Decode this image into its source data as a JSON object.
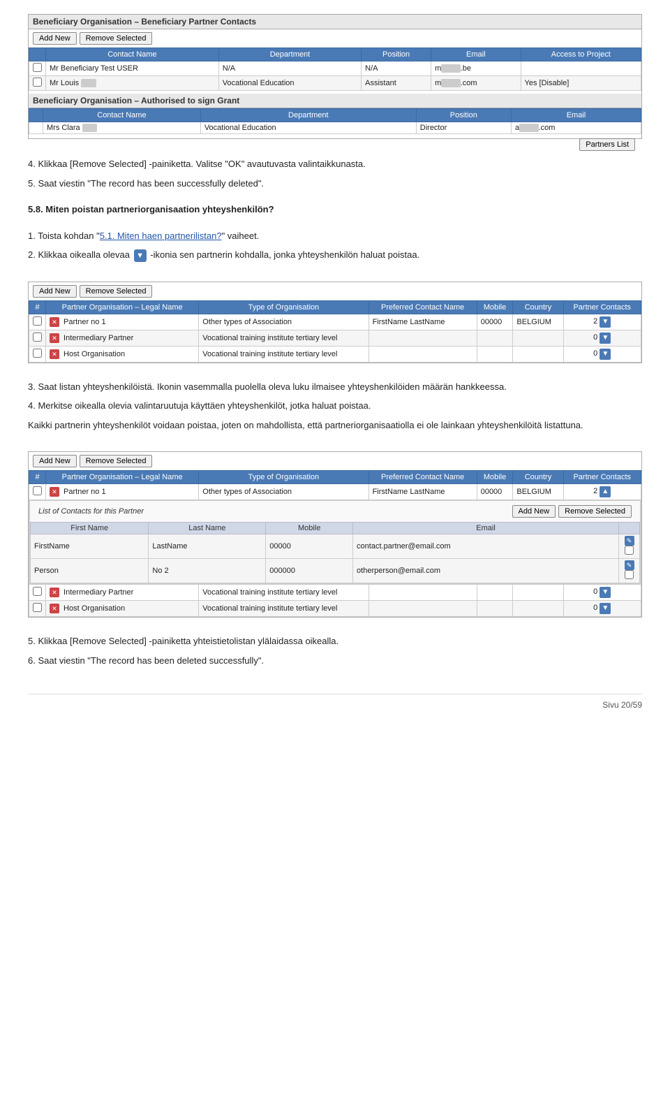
{
  "top_section": {
    "title": "Beneficiary Organisation – Beneficiary Partner Contacts",
    "add_btn": "Add New",
    "remove_btn": "Remove Selected",
    "table": {
      "headers": [
        "Contact Name",
        "Department",
        "Position",
        "Email",
        "Access to Project"
      ],
      "rows": [
        {
          "checkbox": true,
          "name": "Mr Beneficiary Test USER",
          "department": "N/A",
          "position": "N/A",
          "email_prefix": "m",
          "email_suffix": ".be",
          "access": ""
        },
        {
          "checkbox": true,
          "name": "Mr Louis",
          "department": "Vocational Education",
          "position": "Assistant",
          "email_prefix": "m",
          "email_suffix": ".com",
          "access": "Yes [Disable]"
        }
      ]
    }
  },
  "auth_section": {
    "title": "Beneficiary Organisation – Authorised to sign Grant",
    "table": {
      "headers": [
        "Contact Name",
        "Department",
        "Position",
        "Email"
      ],
      "rows": [
        {
          "name": "Mrs Clara",
          "department": "Vocational Education",
          "position": "Director",
          "email_prefix": "a",
          "email_suffix": ".com"
        }
      ]
    },
    "partners_list_btn": "Partners List"
  },
  "steps": [
    {
      "number": "4.",
      "text": "Klikkaa [Remove Selected] -painiketta. Valitse \"OK\" avautuvasta valintaikkunasta."
    },
    {
      "number": "5.",
      "text": "Saat viestin \"The record has been successfully deleted\"."
    }
  ],
  "section58": {
    "heading": "5.8. Miten poistan partneriorganisaation yhteyshenkilön?",
    "step1_num": "1.",
    "step1_text": "Toista kohdan \"",
    "step1_link": "5.1. Miten haen partnerilistan?",
    "step1_end": "\" vaiheet.",
    "step2_num": "2.",
    "step2_text": "Klikkaa oikealla olevaa",
    "step2_rest": "-ikonia sen partnerin kohdalla, jonka yhteyshenkilön haluat poistaa."
  },
  "partners_table1": {
    "add_btn": "Add New",
    "remove_btn": "Remove Selected",
    "headers": [
      "#",
      "Partner Organisation – Legal Name",
      "Type of Organisation",
      "Preferred Contact Name",
      "Mobile",
      "Country",
      "Partner Contacts"
    ],
    "rows": [
      {
        "checkbox": true,
        "num": "",
        "name": "Partner no 1",
        "type": "Other types of Association",
        "contact": "FirstName LastName",
        "mobile": "00000",
        "country": "BELGIUM",
        "contacts_count": "2",
        "expanded": false
      },
      {
        "checkbox": true,
        "num": "",
        "name": "Intermediary Partner",
        "type": "Vocational training institute tertiary level",
        "contact": "",
        "mobile": "",
        "country": "",
        "contacts_count": "0",
        "expanded": false
      },
      {
        "checkbox": true,
        "num": "",
        "name": "Host Organisation",
        "type": "Vocational training institute tertiary level",
        "contact": "",
        "mobile": "",
        "country": "",
        "contacts_count": "0",
        "expanded": false
      }
    ]
  },
  "step3": {
    "num": "3.",
    "text": "Saat listan yhteyshenkilöistä."
  },
  "step3b_text": "Ikonin vasemmalla puolella oleva luku ilmaisee yhteyshenkilöiden määrän hankkeessa.",
  "step4": {
    "num": "4.",
    "text": "Merkitse oikealla olevia valintaruutuja käyttäen yhteyshenkilöt, jotka haluat poistaa."
  },
  "step4b_text": "Kaikki partnerin yhteyshenkilöt voidaan poistaa, joten on mahdollista, että partneriorganisaatiolla ei ole lainkaan yhteyshenkilöitä listattuna.",
  "partners_table2": {
    "add_btn": "Add New",
    "remove_btn": "Remove Selected",
    "headers": [
      "#",
      "Partner Organisation – Legal Name",
      "Type of Organisation",
      "Preferred Contact Name",
      "Mobile",
      "Country",
      "Partner Contacts"
    ],
    "rows": [
      {
        "checkbox": true,
        "name": "Partner no 1",
        "type": "Other types of Association",
        "contact": "FirstName LastName",
        "mobile": "00000",
        "country": "BELGIUM",
        "contacts_count": "2",
        "expanded": true
      },
      {
        "checkbox": true,
        "name": "Intermediary Partner",
        "type": "Vocational training institute tertiary level",
        "contact": "",
        "mobile": "",
        "country": "",
        "contacts_count": "0",
        "expanded": false
      },
      {
        "checkbox": true,
        "name": "Host Organisation",
        "type": "Vocational training institute tertiary level",
        "contact": "",
        "mobile": "",
        "country": "",
        "contacts_count": "0",
        "expanded": false
      }
    ],
    "contacts_subtable": {
      "title": "List of Contacts for this Partner",
      "add_btn": "Add New",
      "remove_btn": "Remove Selected",
      "headers": [
        "First Name",
        "Last Name",
        "Mobile",
        "Email"
      ],
      "rows": [
        {
          "first": "FirstName",
          "last": "LastName",
          "mobile": "00000",
          "email": "contact.partner@email.com",
          "has_check": true
        },
        {
          "first": "Person",
          "last": "No 2",
          "mobile": "000000",
          "email": "otherperson@email.com",
          "has_check": true
        }
      ]
    }
  },
  "bottom_steps": [
    {
      "num": "5.",
      "text": "Klikkaa [Remove Selected] -painiketta yhteistietolistan ylälaidassa oikealla."
    },
    {
      "num": "6.",
      "text": "Saat viestin \"The record has been deleted successfully\"."
    }
  ],
  "footer": {
    "text": "Sivu 20/59"
  }
}
